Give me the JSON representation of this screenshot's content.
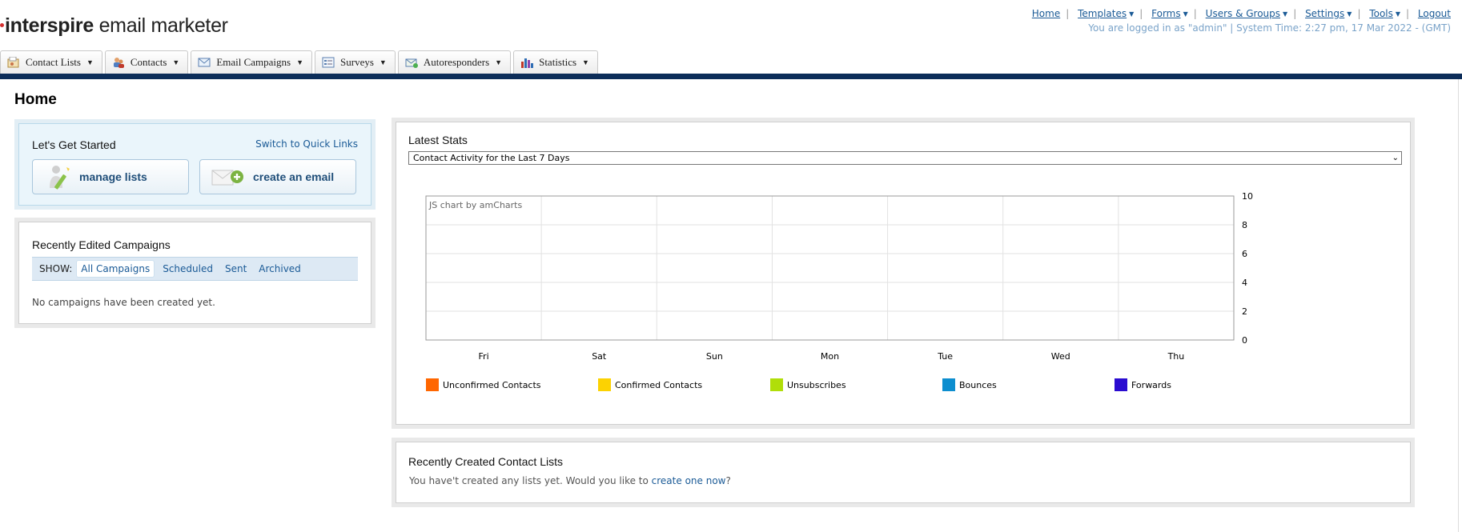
{
  "app": {
    "logo_bold": "interspire",
    "logo_light": " email marketer"
  },
  "topnav": {
    "items": [
      {
        "label": "Home",
        "dropdown": false
      },
      {
        "label": "Templates",
        "dropdown": true
      },
      {
        "label": "Forms",
        "dropdown": true
      },
      {
        "label": "Users & Groups",
        "dropdown": true
      },
      {
        "label": "Settings",
        "dropdown": true
      },
      {
        "label": "Tools",
        "dropdown": true
      },
      {
        "label": "Logout",
        "dropdown": false
      }
    ],
    "login_info": "You are logged in as \"admin\" | System Time: 2:27 pm, 17 Mar 2022 - (GMT)"
  },
  "tabs": [
    {
      "label": "Contact Lists",
      "icon": "contact-lists-icon"
    },
    {
      "label": "Contacts",
      "icon": "contacts-icon"
    },
    {
      "label": "Email Campaigns",
      "icon": "email-campaigns-icon"
    },
    {
      "label": "Surveys",
      "icon": "surveys-icon"
    },
    {
      "label": "Autoresponders",
      "icon": "autoresponders-icon"
    },
    {
      "label": "Statistics",
      "icon": "statistics-icon"
    }
  ],
  "page": {
    "title": "Home"
  },
  "getstarted": {
    "title": "Let's Get Started",
    "quick_link": "Switch to Quick Links",
    "manage_lists": "manage lists",
    "create_email": "create an email"
  },
  "campaigns": {
    "title": "Recently Edited Campaigns",
    "show_label": "SHOW:",
    "filters": [
      "All Campaigns",
      "Scheduled",
      "Sent",
      "Archived"
    ],
    "active_filter": "All Campaigns",
    "empty": "No campaigns have been created yet."
  },
  "stats": {
    "title": "Latest Stats",
    "selected_range": "Contact Activity for the Last 7 Days",
    "watermark": "JS chart by amCharts"
  },
  "chart_data": {
    "type": "line",
    "categories": [
      "Fri",
      "Sat",
      "Sun",
      "Mon",
      "Tue",
      "Wed",
      "Thu"
    ],
    "y_ticks": [
      10,
      8,
      6,
      4,
      2,
      0
    ],
    "ylim": [
      0,
      10
    ],
    "y_axis_side": "right",
    "grid": true,
    "legend_position": "bottom",
    "series": [
      {
        "name": "Unconfirmed Contacts",
        "color": "#ff6600",
        "values": [
          0,
          0,
          0,
          0,
          0,
          0,
          0
        ]
      },
      {
        "name": "Confirmed Contacts",
        "color": "#fcd202",
        "values": [
          0,
          0,
          0,
          0,
          0,
          0,
          0
        ]
      },
      {
        "name": "Unsubscribes",
        "color": "#b0de09",
        "values": [
          0,
          0,
          0,
          0,
          0,
          0,
          0
        ]
      },
      {
        "name": "Bounces",
        "color": "#0d8ecf",
        "values": [
          0,
          0,
          0,
          0,
          0,
          0,
          0
        ]
      },
      {
        "name": "Forwards",
        "color": "#2a0cd0",
        "values": [
          0,
          0,
          0,
          0,
          0,
          0,
          0
        ]
      }
    ]
  },
  "lists": {
    "title": "Recently Created Contact Lists",
    "empty_text": "You have't created any lists yet. Would you like to ",
    "create_link": "create one now",
    "suffix": "?"
  }
}
